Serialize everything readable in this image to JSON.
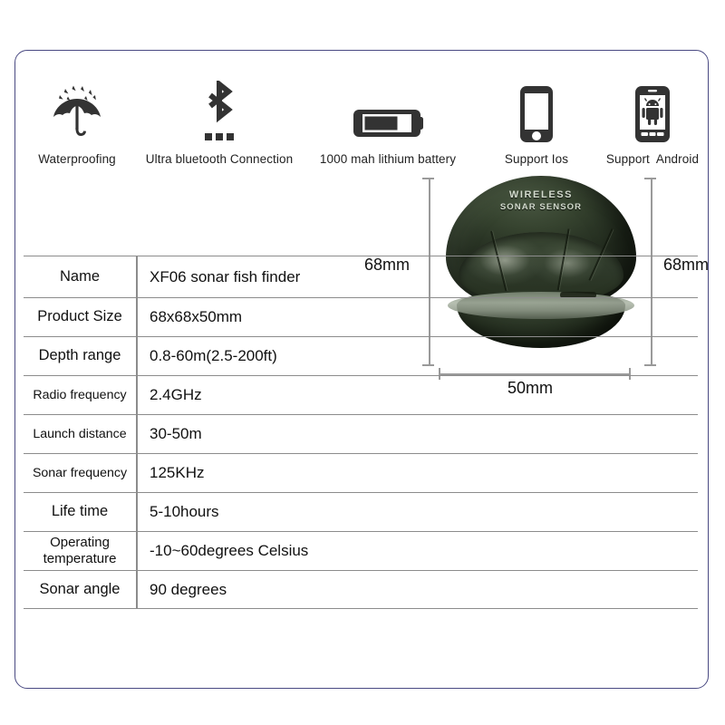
{
  "frame": {
    "border_color": "#4a4a82"
  },
  "features": [
    {
      "icon": "umbrella-rain-icon",
      "caption": "Waterproofing"
    },
    {
      "icon": "bluetooth-icon",
      "caption": "Ultra bluetooth Connection"
    },
    {
      "icon": "battery-icon",
      "caption": "1000 mah lithium battery"
    },
    {
      "icon": "iphone-icon",
      "caption": "Support Ios"
    },
    {
      "icon": "android-phone-icon",
      "caption": "Support  Android"
    }
  ],
  "spec_table": {
    "rows": [
      {
        "label": "Name",
        "value": "XF06 sonar fish finder"
      },
      {
        "label": "Product Size",
        "value": "68x68x50mm"
      },
      {
        "label": "Depth range",
        "value": "0.8-60m(2.5-200ft)"
      },
      {
        "label": "Radio frequency",
        "value": "2.4GHz"
      },
      {
        "label": "Launch distance",
        "value": "30-50m"
      },
      {
        "label": "Sonar frequency",
        "value": "125KHz"
      },
      {
        "label": "Life time",
        "value": "5-10hours"
      },
      {
        "label": "Operating temperature",
        "value": "-10~60degrees Celsius"
      },
      {
        "label": "Sonar angle",
        "value": "90 degrees"
      }
    ]
  },
  "product": {
    "brand_line1": "WIRELESS",
    "brand_line2": "SONAR  SENSOR",
    "body_color": "#2e392a",
    "dimensions": {
      "left": "68mm",
      "right": "68mm",
      "bottom": "50mm"
    }
  }
}
